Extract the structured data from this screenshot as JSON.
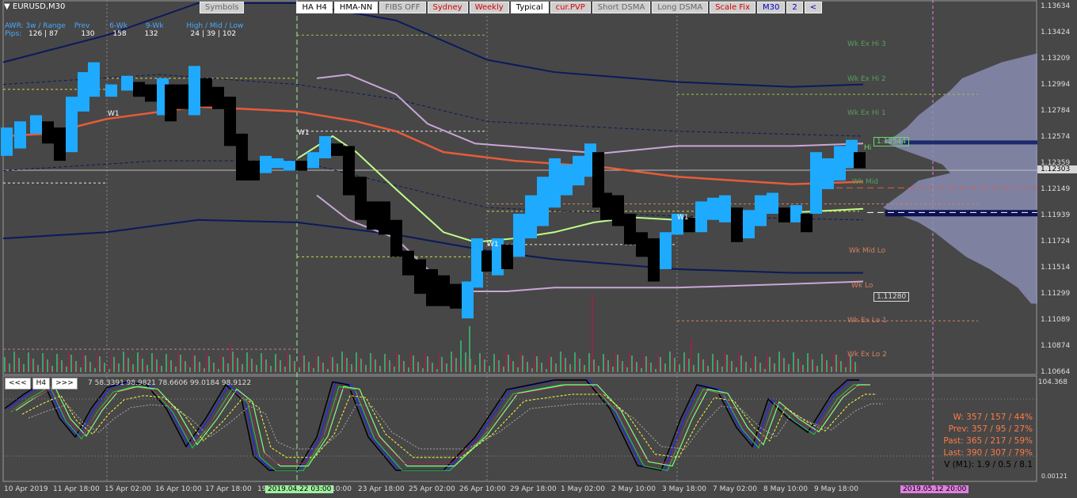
{
  "symbol": "EURUSD,M30",
  "toolbar": [
    {
      "label": "Symbols",
      "style": "muted"
    },
    {
      "label": "HA H4",
      "style": "dark"
    },
    {
      "label": "HMA-NN",
      "style": "dark"
    },
    {
      "label": "FIBS OFF",
      "style": "muted"
    },
    {
      "label": "Sydney",
      "style": "red"
    },
    {
      "label": "Weekly",
      "style": "red"
    },
    {
      "label": "Typical",
      "style": "dark"
    },
    {
      "label": "cur.PVP",
      "style": "red"
    },
    {
      "label": "Short DSMA",
      "style": "muted"
    },
    {
      "label": "Long DSMA",
      "style": "muted"
    },
    {
      "label": "Scale Fix",
      "style": "red"
    },
    {
      "label": "M30",
      "style": "blue"
    },
    {
      "label": "2",
      "style": "blue"
    },
    {
      "label": "<",
      "style": "blue"
    }
  ],
  "awr": {
    "header": [
      "AWR: 3w / Range",
      "Prev",
      "6-Wk",
      "9-Wk",
      "High / Mid / Low"
    ],
    "row_label": "Pips:",
    "values": [
      "126 | 87",
      "130",
      "158",
      "132",
      "24 | 39 | 102"
    ]
  },
  "price_axis": [
    "1.13634",
    "1.13424",
    "1.13209",
    "1.12994",
    "1.12784",
    "1.12574",
    "1.12359",
    "1.12149",
    "1.11939",
    "1.11724",
    "1.11514",
    "1.11299",
    "1.11089",
    "1.10874",
    "1.10664"
  ],
  "current_price": "1.12303",
  "box_labels": {
    "high": "1.12544",
    "low": "1.11280"
  },
  "week_labels": [
    "Wk Ex Hi 3",
    "Wk Ex Hi 2",
    "Wk Ex Hi 1",
    "Wk Mid",
    "Wk Mid Lo",
    "Wk Lo",
    "Wk Ex Lo 1",
    "Wk Ex Lo 2",
    "Hi"
  ],
  "w1_label": "W1",
  "time_axis": [
    "10 Apr 2019",
    "11 Apr 18:00",
    "15 Apr 02:00",
    "16 Apr 10:00",
    "17 Apr 18:00",
    "19",
    "23 Apr 18:00",
    "25 Apr 02:00",
    "26 Apr 10:00",
    "29 Apr 18:00",
    "1 May 02:00",
    "2 May 10:00",
    "3 May 18:00",
    "7 May 02:00",
    "8 May 10:00",
    "9 May 18:00"
  ],
  "cursor_date": "2019.04.22 03:00",
  "cursor_date_after": "10:00",
  "future_date": "2019.05.12 20:00",
  "sub_toolbar": [
    "<<<",
    "H4",
    ">>>"
  ],
  "sub_values": "7 58.3391 98.9821 78.6606 99.0184 98.9122",
  "sub_axis": {
    "top": "104.368",
    "bottom": "0.00121"
  },
  "stats": {
    "w": "W: 357 / 157 / 44%",
    "prev": "Prev: 357 / 95 / 27%",
    "past": "Past: 365 / 217 / 59%",
    "last": "Last: 390 / 307 / 79%",
    "v": "V (M1): 1.9 / 0.5 / 8.1"
  },
  "colors": {
    "bg": "#474747",
    "bull": "#1eaaff",
    "bear": "#000000",
    "accent": "#e85b3a",
    "lavender": "#c9a6d6",
    "navy": "#0a1a5c",
    "lime": "#bfff8a",
    "yellow": "#ffff3c",
    "magenta": "#ff66ff"
  }
}
